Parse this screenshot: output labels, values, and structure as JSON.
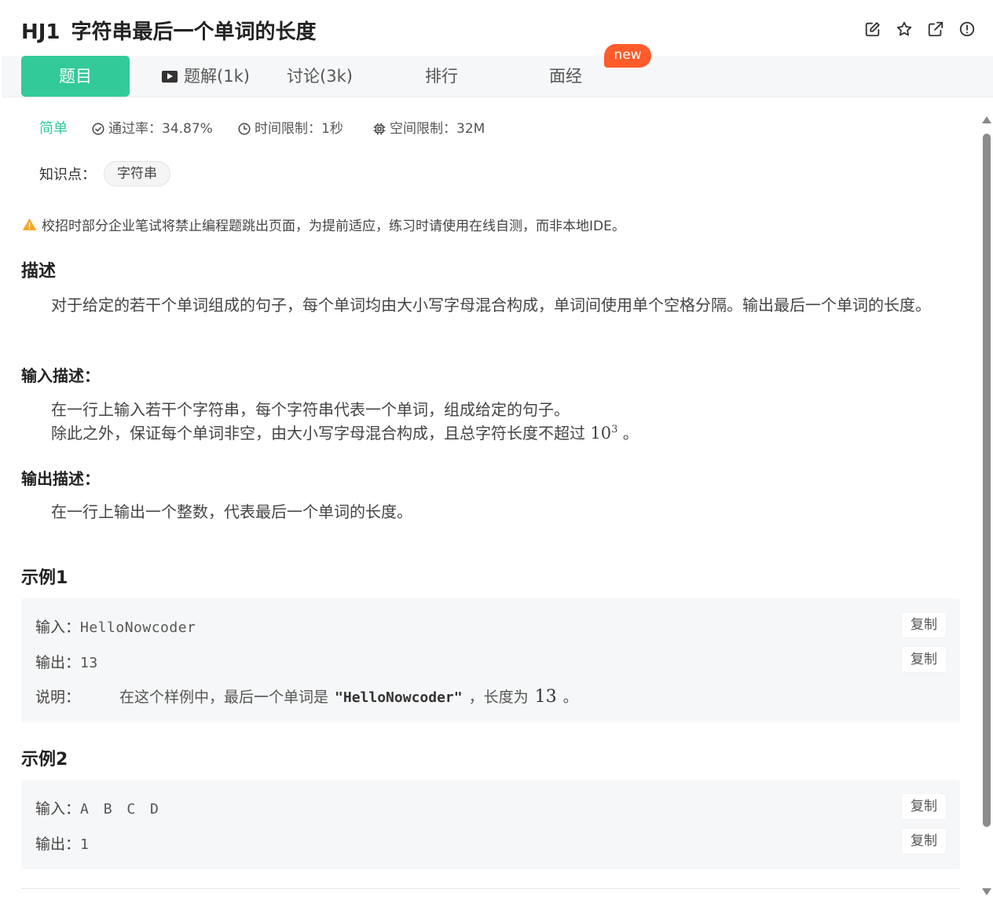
{
  "header": {
    "code": "HJ1",
    "title": "字符串最后一个单词的长度",
    "icons": [
      "edit-icon",
      "star-icon",
      "external-link-icon",
      "info-icon"
    ]
  },
  "tabs": [
    {
      "label": "题目",
      "active": true
    },
    {
      "label": "题解(1k)",
      "icon": "video-icon"
    },
    {
      "label": "讨论(3k)"
    },
    {
      "label": "排行"
    },
    {
      "label": "面经"
    }
  ],
  "new_badge": "new",
  "meta": {
    "difficulty": "简单",
    "pass_rate": "通过率：34.87%",
    "time_limit": "时间限制：1秒",
    "space_limit": "空间限制：32M"
  },
  "knowledge": {
    "label": "知识点：",
    "tag": "字符串"
  },
  "notice": "校招时部分企业笔试将禁止编程题跳出页面，为提前适应，练习时请使用在线自测，而非本地IDE。",
  "description": {
    "heading": "描述",
    "text": "对于给定的若干个单词组成的句子，每个单词均由大小写字母混合构成，单词间使用单个空格分隔。输出最后一个单词的长度。"
  },
  "input_desc": {
    "heading": "输入描述：",
    "line1": "在一行上输入若干个字符串，每个字符串代表一个单词，组成给定的句子。",
    "line2_prefix": "除此之外，保证每个单词非空，由大小写字母混合构成，且总字符长度不超过",
    "line2_base": "10",
    "line2_exp": "3",
    "line2_suffix": "。"
  },
  "output_desc": {
    "heading": "输出描述：",
    "line1": "在一行上输出一个整数，代表最后一个单词的长度。"
  },
  "examples": [
    {
      "heading": "示例1",
      "input_label": "输入：",
      "input": "HelloNowcoder",
      "output_label": "输出：",
      "output": "13",
      "explain_label": "说明：",
      "explain_prefix": "在这个样例中，最后一个单词是",
      "explain_word": "\"HelloNowcoder\"",
      "explain_mid": "，长度为",
      "explain_num": "13",
      "explain_suffix": "。"
    },
    {
      "heading": "示例2",
      "input_label": "输入：",
      "input": "A B C D",
      "output_label": "输出：",
      "output": "1"
    }
  ],
  "copy_label": "复制"
}
